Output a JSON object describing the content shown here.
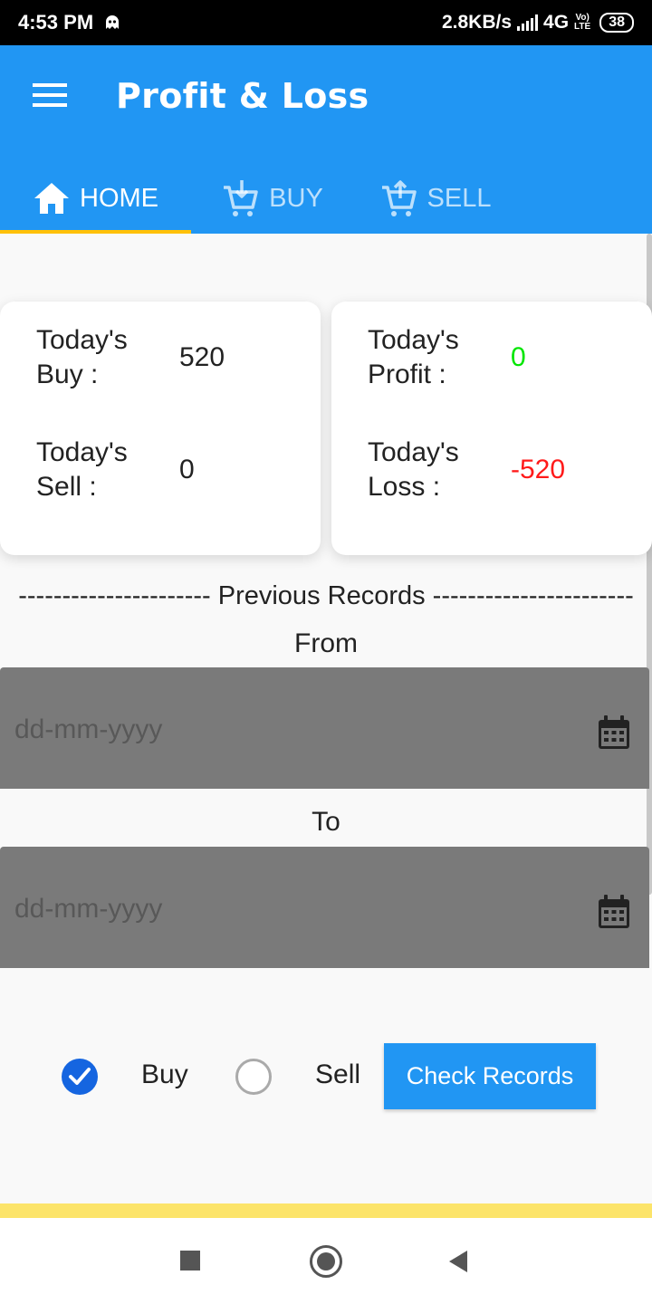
{
  "status_bar": {
    "time": "4:53 PM",
    "network_speed": "2.8KB/s",
    "network_type": "4G",
    "volte_top": "Vo)",
    "volte_bottom": "LTE",
    "battery": "38"
  },
  "app_bar": {
    "title": "Profit & Loss"
  },
  "tabs": [
    {
      "label": "HOME",
      "icon": "home-icon",
      "selected": true
    },
    {
      "label": "BUY",
      "icon": "cart-download-icon",
      "selected": false
    },
    {
      "label": "SELL",
      "icon": "cart-upload-icon",
      "selected": false
    }
  ],
  "summary": {
    "buy_label": "Today's\nBuy :",
    "buy_value": "520",
    "sell_label": "Today's\nSell :",
    "sell_value": "0",
    "profit_label": "Today's\nProfit :",
    "profit_value": "0",
    "loss_label": "Today's\nLoss :",
    "loss_value": "-520"
  },
  "records": {
    "title": "---------------------- Previous Records -----------------------",
    "from_label": "From",
    "to_label": "To",
    "from_placeholder": "dd-mm-yyyy",
    "to_placeholder": "dd-mm-yyyy",
    "option_buy": "Buy",
    "option_sell": "Sell",
    "selected_option": "Buy",
    "check_button": "Check Records"
  },
  "colors": {
    "primary": "#2196f3",
    "tab_indicator": "#ffc107",
    "profit": "#00e600",
    "loss": "#ff1a1a",
    "radio_checked": "#1565e0"
  }
}
